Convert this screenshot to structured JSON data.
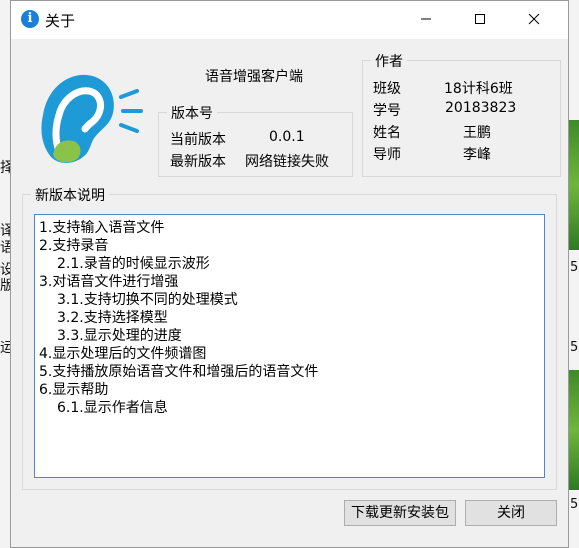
{
  "window": {
    "title": "关于",
    "app_name": "语音增强客户端"
  },
  "version": {
    "legend": "版本号",
    "current_label": "当前版本",
    "current_value": "0.0.1",
    "latest_label": "最新版本",
    "latest_value": "网络链接失败"
  },
  "author": {
    "legend": "作者",
    "rows": [
      {
        "label": "班级",
        "value": "18计科6班"
      },
      {
        "label": "学号",
        "value": "20183823"
      },
      {
        "label": "姓名",
        "value": "王鹏"
      },
      {
        "label": "导师",
        "value": "李峰"
      }
    ]
  },
  "notes": {
    "legend": "新版本说明",
    "lines": [
      "1.支持输入语音文件",
      "2.支持录音",
      "    2.1.录音的时候显示波形",
      "3.对语音文件进行增强",
      "    3.1.支持切换不同的处理模式",
      "    3.2.支持选择模型",
      "    3.3.显示处理的进度",
      "4.显示处理后的文件频谱图",
      "5.支持播放原始语音文件和增强后的语音文件",
      "6.显示帮助",
      "    6.1.显示作者信息"
    ]
  },
  "buttons": {
    "download": "下载更新安装包",
    "close": "关闭"
  },
  "background": {
    "left_chars": [
      "择",
      "译",
      "语",
      "设",
      "版",
      "运"
    ],
    "right_nums": [
      "5",
      "5",
      "5"
    ]
  },
  "colors": {
    "ear_blue": "#1e9bd7",
    "ear_green": "#8bc34a",
    "title_icon": "#1a7fd8"
  }
}
